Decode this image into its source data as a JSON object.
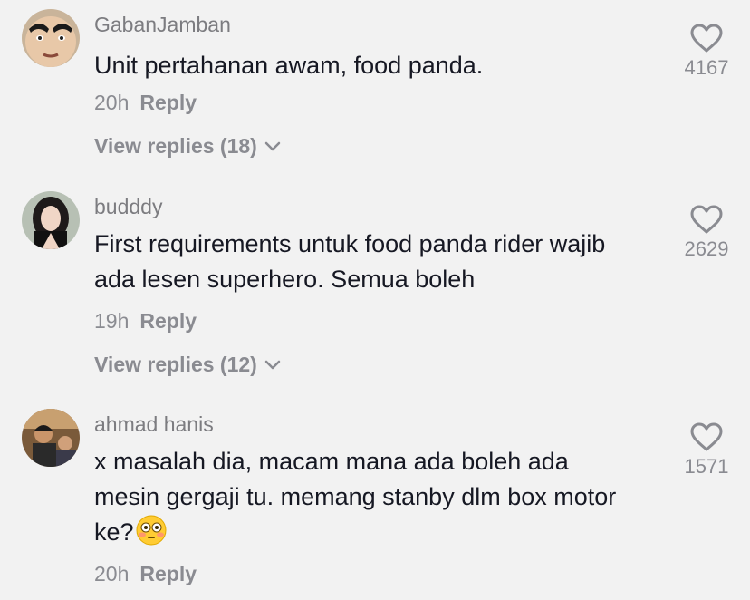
{
  "comments": [
    {
      "username": "GabanJamban",
      "text": "Unit pertahanan awam, food panda.",
      "time": "20h",
      "reply_label": "Reply",
      "view_replies": "View replies (18)",
      "likes": "4167",
      "avatar_icon": "cartoon-face-avatar"
    },
    {
      "username": "budddy",
      "text": "First requirements untuk food panda rider wajib ada lesen superhero. Semua boleh",
      "time": "19h",
      "reply_label": "Reply",
      "view_replies": "View replies (12)",
      "likes": "2629",
      "avatar_icon": "girl-photo-avatar"
    },
    {
      "username": "ahmad hanis",
      "text": "x masalah dia, macam mana ada boleh ada mesin gergaji tu. memang stanby dlm box motor ke?",
      "emoji": "flushed-face",
      "time": "20h",
      "reply_label": "Reply",
      "likes": "1571",
      "avatar_icon": "man-photo-avatar"
    }
  ],
  "colors": {
    "background": "#f2f2f2",
    "text": "#161823",
    "muted": "#8a8b91"
  }
}
